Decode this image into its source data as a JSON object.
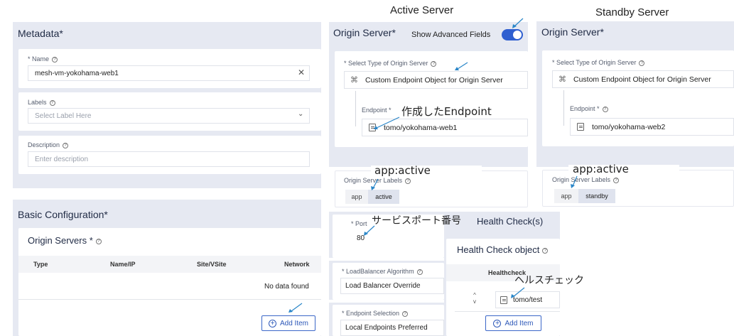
{
  "annotations": {
    "active_server": "Active Server",
    "standby_server": "Standby Server",
    "endpoint_created": "作成したEndpoint",
    "app_active_1": "app:active",
    "app_active_2": "app:active",
    "service_port": "サービスポート番号",
    "health_check_jp": "ヘルスチェック"
  },
  "metadata": {
    "title": "Metadata",
    "required": "*",
    "name_label": "* Name",
    "name_value": "mesh-vm-yokohama-web1",
    "labels_label": "Labels",
    "labels_placeholder": "Select Label Here",
    "description_label": "Description",
    "description_placeholder": "Enter description"
  },
  "basic_config": {
    "title": "Basic Configuration",
    "required": "*",
    "origin_servers_title": "Origin Servers *",
    "columns": [
      "Type",
      "Name/IP",
      "Site/VSite",
      "Network"
    ],
    "empty_text": "No data found",
    "add_item": "Add Item"
  },
  "active_origin": {
    "title": "Origin Server",
    "required": "*",
    "advanced_toggle_label": "Show Advanced Fields",
    "select_type_label": "* Select Type of Origin Server",
    "select_type_value": "Custom Endpoint Object for Origin Server",
    "endpoint_label": "Endpoint *",
    "endpoint_value": "tomo/yokohama-web1",
    "labels_label": "Origin Server Labels",
    "label_key": "app",
    "label_value": "active",
    "port_label": "* Port",
    "port_value": "80",
    "lb_algorithm_label": "* LoadBalancer Algorithm",
    "lb_algorithm_value": "Load Balancer Override",
    "endpoint_selection_label": "* Endpoint Selection",
    "endpoint_selection_value": "Local Endpoints Preferred"
  },
  "standby_origin": {
    "title": "Origin Server",
    "required": "*",
    "select_type_label": "* Select Type of Origin Server",
    "select_type_value": "Custom Endpoint Object for Origin Server",
    "endpoint_label": "Endpoint *",
    "endpoint_value": "tomo/yokohama-web2",
    "labels_label": "Origin Server Labels",
    "label_key": "app",
    "label_value": "standby"
  },
  "health_check": {
    "section_title": "Health Check(s)",
    "object_title": "Health Check object",
    "column": "Healthcheck",
    "item_value": "tomo/test",
    "add_item": "Add Item"
  },
  "colors": {
    "panel": "#e6e9f2",
    "accent": "#2d58b8",
    "toggle": "#2f5fd0",
    "arrow": "#2a86c8"
  }
}
